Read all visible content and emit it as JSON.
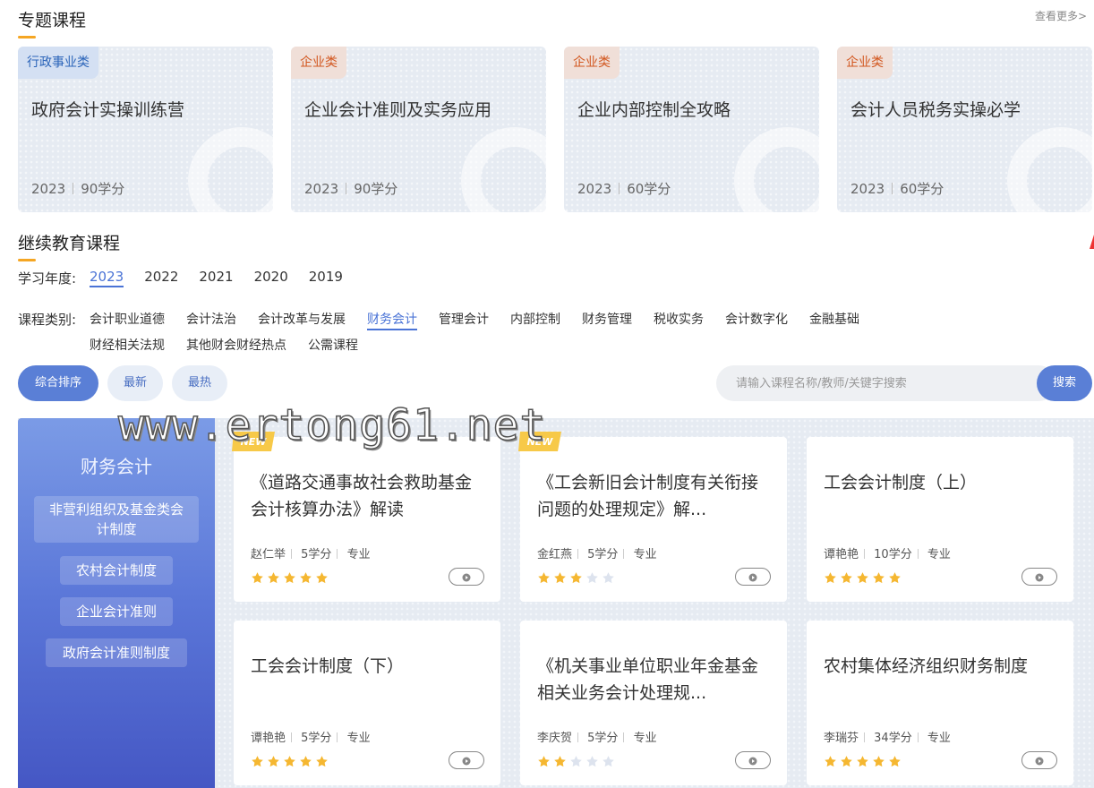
{
  "topic_section": {
    "title": "专题课程",
    "more": "查看更多>",
    "cards": [
      {
        "tag": "行政事业类",
        "tag_style": "blue",
        "title": "政府会计实操训练营",
        "year": "2023",
        "credits": "90学分"
      },
      {
        "tag": "企业类",
        "tag_style": "orange",
        "title": "企业会计准则及实务应用",
        "year": "2023",
        "credits": "90学分"
      },
      {
        "tag": "企业类",
        "tag_style": "orange",
        "title": "企业内部控制全攻略",
        "year": "2023",
        "credits": "60学分"
      },
      {
        "tag": "企业类",
        "tag_style": "orange",
        "title": "会计人员税务实操必学",
        "year": "2023",
        "credits": "60学分"
      }
    ]
  },
  "ce_section": {
    "title": "继续教育课程",
    "year_label": "学习年度:",
    "years": [
      "2023",
      "2022",
      "2021",
      "2020",
      "2019"
    ],
    "active_year": "2023",
    "category_label": "课程类别:",
    "categories": [
      "会计职业道德",
      "会计法治",
      "会计改革与发展",
      "财务会计",
      "管理会计",
      "内部控制",
      "财务管理",
      "税收实务",
      "会计数字化",
      "金融基础",
      "财经相关法规",
      "其他财会财经热点",
      "公需课程"
    ],
    "active_category": "财务会计"
  },
  "sort": {
    "buttons": [
      "综合排序",
      "最新",
      "最热"
    ],
    "active": "综合排序"
  },
  "search": {
    "placeholder": "请输入课程名称/教师/关键字搜索",
    "button": "搜索"
  },
  "side_panel": {
    "title": "财务会计",
    "items": [
      "非营利组织及基金类会计制度",
      "农村会计制度",
      "企业会计准则",
      "政府会计准则制度"
    ]
  },
  "courses": [
    {
      "title": "《道路交通事故社会救助基金会计核算办法》解读",
      "teacher": "赵仁举",
      "credits": "5学分",
      "level": "专业",
      "rating": 5,
      "is_new": true
    },
    {
      "title": "《工会新旧会计制度有关衔接问题的处理规定》解...",
      "teacher": "金红燕",
      "credits": "5学分",
      "level": "专业",
      "rating": 3,
      "is_new": true
    },
    {
      "title": "工会会计制度（上）",
      "teacher": "谭艳艳",
      "credits": "10学分",
      "level": "专业",
      "rating": 5,
      "is_new": false
    },
    {
      "title": "工会会计制度（下）",
      "teacher": "谭艳艳",
      "credits": "5学分",
      "level": "专业",
      "rating": 5,
      "is_new": false
    },
    {
      "title": "《机关事业单位职业年金基金相关业务会计处理规...",
      "teacher": "李庆贺",
      "credits": "5学分",
      "level": "专业",
      "rating": 2,
      "is_new": false
    },
    {
      "title": "农村集体经济组织财务制度",
      "teacher": "李瑞芬",
      "credits": "34学分",
      "level": "专业",
      "rating": 5,
      "is_new": false
    }
  ],
  "new_badge": "NEW",
  "watermark": "www.ertong61.net",
  "colors": {
    "accent": "#5a7fd6",
    "underline": "#f5a623",
    "star": "#f5b731",
    "star_empty": "#dde3ee"
  }
}
